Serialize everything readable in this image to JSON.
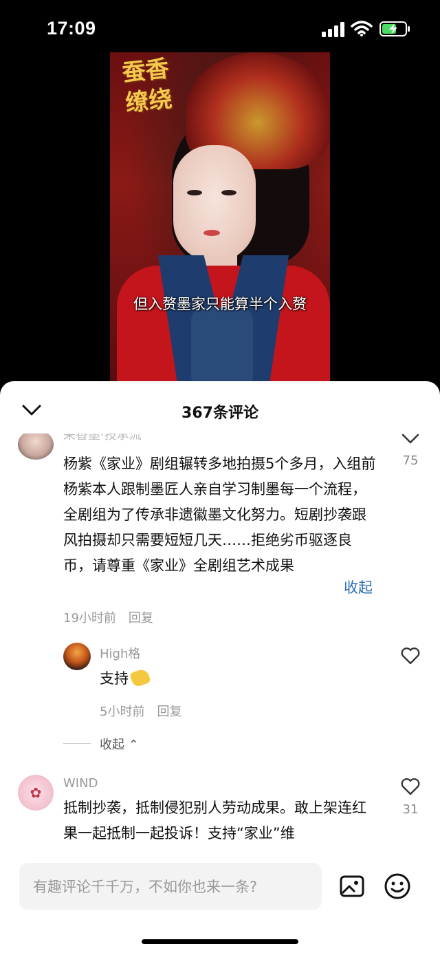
{
  "status_bar": {
    "time": "17:09"
  },
  "video": {
    "title_art": "蚕香缭绕",
    "subtitle": "但入赘墨家只能算半个入赘"
  },
  "comments_header": {
    "title": "367条评论"
  },
  "comments": [
    {
      "user": "采香墨·技承流",
      "text": "杨紫《家业》剧组辗转多地拍摄5个多月，入组前杨紫本人跟制墨匠人亲自学习制墨每一个流程，全剧组为了传承非遗徽墨文化努力。短剧抄袭跟风拍摄却只需要短短几天……拒绝劣币驱逐良币，请尊重《家业》全剧组艺术成果",
      "fold_label": "收起",
      "time": "19小时前",
      "reply_label": "回复",
      "likes": "75",
      "replies": [
        {
          "user": "High格",
          "text": "支持",
          "time": "5小时前",
          "reply_label": "回复"
        }
      ],
      "collapse_label": "收起 ⌃"
    },
    {
      "user": "WIND",
      "text": "抵制抄袭，抵制侵犯别人劳动成果。敢上架连红果一起抵制一起投诉！支持“家业”维",
      "likes": "31"
    }
  ],
  "input": {
    "placeholder": "有趣评论千千万，不如你也来一条?"
  }
}
